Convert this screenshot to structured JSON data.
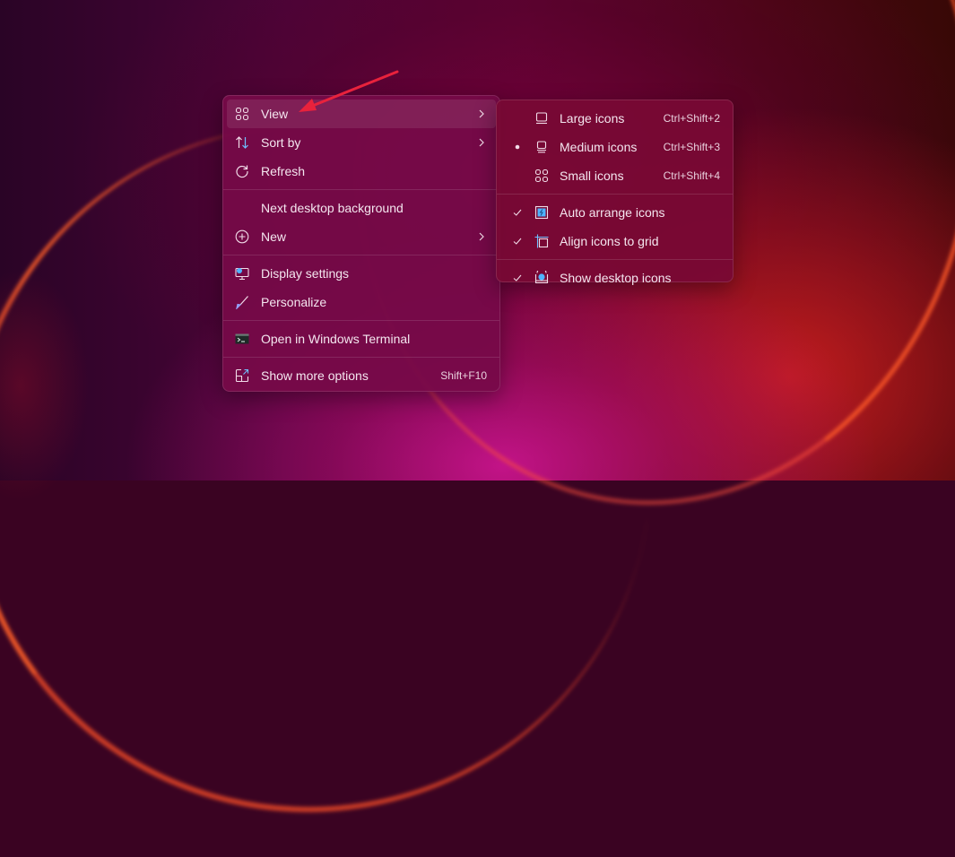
{
  "main_menu": {
    "items": [
      {
        "label": "View",
        "icon": "view-grid-icon",
        "has_submenu": true,
        "highlighted": true
      },
      {
        "label": "Sort by",
        "icon": "sort-icon",
        "has_submenu": true
      },
      {
        "label": "Refresh",
        "icon": "refresh-icon"
      },
      {
        "label": "Next desktop background"
      },
      {
        "label": "New",
        "icon": "add-circle-icon",
        "has_submenu": true
      },
      {
        "label": "Display settings",
        "icon": "display-settings-icon"
      },
      {
        "label": "Personalize",
        "icon": "brush-icon"
      },
      {
        "label": "Open in Windows Terminal",
        "icon": "terminal-icon"
      },
      {
        "label": "Show more options",
        "icon": "show-more-icon",
        "shortcut": "Shift+F10"
      }
    ]
  },
  "view_submenu": {
    "items": [
      {
        "label": "Large icons",
        "icon": "large-icons-icon",
        "shortcut": "Ctrl+Shift+2",
        "marker": "none"
      },
      {
        "label": "Medium icons",
        "icon": "medium-icons-icon",
        "shortcut": "Ctrl+Shift+3",
        "marker": "bullet"
      },
      {
        "label": "Small icons",
        "icon": "small-icons-icon",
        "shortcut": "Ctrl+Shift+4",
        "marker": "none"
      },
      {
        "label": "Auto arrange icons",
        "icon": "auto-arrange-icon",
        "marker": "check"
      },
      {
        "label": "Align icons to grid",
        "icon": "align-grid-icon",
        "marker": "check"
      },
      {
        "label": "Show desktop icons",
        "icon": "show-desktop-icons-icon",
        "marker": "check"
      }
    ]
  },
  "annotation": {
    "type": "arrow",
    "color": "#e8223c",
    "points_to": "View"
  },
  "colors": {
    "menu_bg": "#760a48",
    "submenu_bg": "#78083a",
    "text": "#f4e6ef",
    "accent_icon": "#4fb3ff"
  }
}
